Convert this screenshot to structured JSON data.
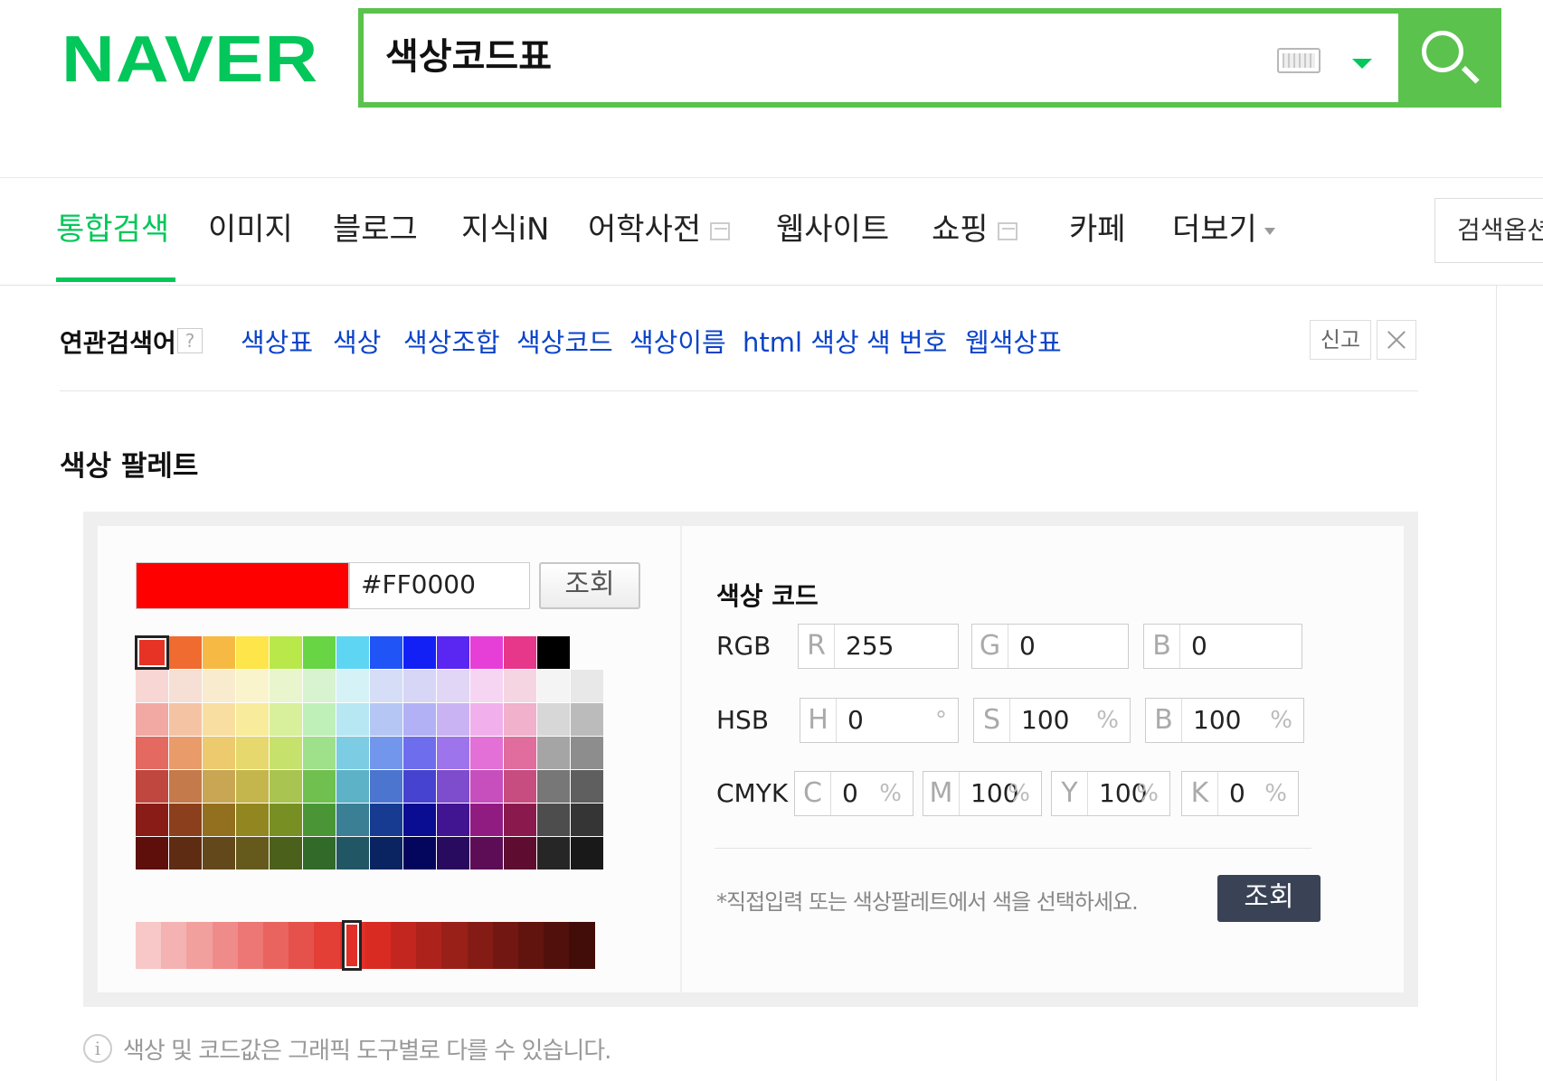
{
  "header": {
    "logo": "NAVER",
    "query": "색상코드표",
    "keyboard_icon": "keyboard-icon",
    "dropdown_icon": "chevron-down-icon",
    "search_icon": "search-icon",
    "brand_color": "#03c75a"
  },
  "tabs": {
    "items": [
      "통합검색",
      "이미지",
      "블로그",
      "지식iN",
      "어학사전",
      "웹사이트",
      "쇼핑",
      "카페",
      "더보기"
    ],
    "active": "통합검색",
    "option": "검색옵션"
  },
  "related": {
    "title": "연관검색어",
    "help": "?",
    "terms": [
      "색상표",
      "색상",
      "색상조합",
      "색상코드",
      "색상이름",
      "html 색상",
      "색 번호",
      "웹색상표"
    ],
    "report": "신고",
    "close_icon": "close-icon"
  },
  "palette": {
    "section_title": "색상 팔레트",
    "current_color": "#FF0000",
    "hex_value": "#FF0000",
    "lookup_label": "조회",
    "grid": [
      [
        "#e63325",
        "#ef6b30",
        "#f6ba44",
        "#fde54a",
        "#b8e84a",
        "#67d544",
        "#5fd5f4",
        "#2154f6",
        "#1320f5",
        "#5a26f2",
        "#e63fd8",
        "#e6378b",
        "#000000"
      ],
      [
        "#f7d6d3",
        "#f6dfd4",
        "#f9ebce",
        "#faf4cd",
        "#e9f5cd",
        "#d7f3cf",
        "#d5f2f6",
        "#d5ddf7",
        "#d7d6f7",
        "#e1d6f5",
        "#f6d5f2",
        "#f6d5e2",
        "#f4f4f4",
        "#e8e8e8"
      ],
      [
        "#f2a9a3",
        "#f4c3a4",
        "#f8dfa1",
        "#f8ec9c",
        "#d8ef9b",
        "#bff0b7",
        "#b7e7f3",
        "#b5c6f5",
        "#b2b1f5",
        "#c9b3f3",
        "#f1b0ec",
        "#f1b0cc",
        "#d7d7d7",
        "#bbbbbb"
      ],
      [
        "#e46960",
        "#e99b6a",
        "#ecca6d",
        "#e6d86c",
        "#c7e26c",
        "#9fe08a",
        "#7ccde3",
        "#7396ed",
        "#6e6ded",
        "#9e74ec",
        "#e270d6",
        "#e06d9d",
        "#a5a5a5",
        "#8d8d8d"
      ],
      [
        "#bf473f",
        "#c47a4b",
        "#c8a653",
        "#c4b64c",
        "#a9c451",
        "#6fc04e",
        "#5db2c8",
        "#4c75cf",
        "#4543cf",
        "#7d4dcd",
        "#c64ebd",
        "#c74c80",
        "#777777",
        "#5f5f5f"
      ],
      [
        "#891c16",
        "#8b3f1c",
        "#92701f",
        "#928620",
        "#788f24",
        "#4a9637",
        "#3a7f93",
        "#173b91",
        "#0a0c91",
        "#411592",
        "#901c81",
        "#8a1a4d",
        "#4d4d4d",
        "#353535"
      ],
      [
        "#5e0f0b",
        "#5e2c13",
        "#62481a",
        "#655a1c",
        "#4b601a",
        "#326a2a",
        "#215764",
        "#0a2361",
        "#04065e",
        "#280b5e",
        "#5c0d56",
        "#5e0d30",
        "#262626",
        "#191919"
      ]
    ],
    "shades": [
      "#f7c8c7",
      "#f4b3b2",
      "#f2a09e",
      "#ef8b89",
      "#ec7774",
      "#e9645f",
      "#e5524b",
      "#e33f37",
      "#e03028",
      "#d92b22",
      "#c3261f",
      "#ad231b",
      "#982019",
      "#851b15",
      "#721711",
      "#61130e",
      "#51100b",
      "#420d09"
    ],
    "selected_shade_index": 8
  },
  "codes": {
    "title": "색상 코드",
    "rgb": {
      "label": "RGB",
      "r": "255",
      "g": "0",
      "b": "0",
      "r_lbl": "R",
      "g_lbl": "G",
      "b_lbl": "B"
    },
    "hsb": {
      "label": "HSB",
      "h": "0",
      "s": "100",
      "b": "100",
      "h_lbl": "H",
      "s_lbl": "S",
      "b_lbl": "B",
      "deg": "°",
      "pct": "%"
    },
    "cmyk": {
      "label": "CMYK",
      "c": "0",
      "m": "100",
      "y": "100",
      "k": "0",
      "c_lbl": "C",
      "m_lbl": "M",
      "y_lbl": "Y",
      "k_lbl": "K",
      "pct": "%"
    },
    "hint": "*직접입력 또는 색상팔레트에서 색을 선택하세요.",
    "lookup_label": "조회"
  },
  "footer": {
    "info": "색상 및 코드값은 그래픽 도구별로 다를 수 있습니다.",
    "info_icon": "info-icon",
    "info_glyph": "i"
  }
}
